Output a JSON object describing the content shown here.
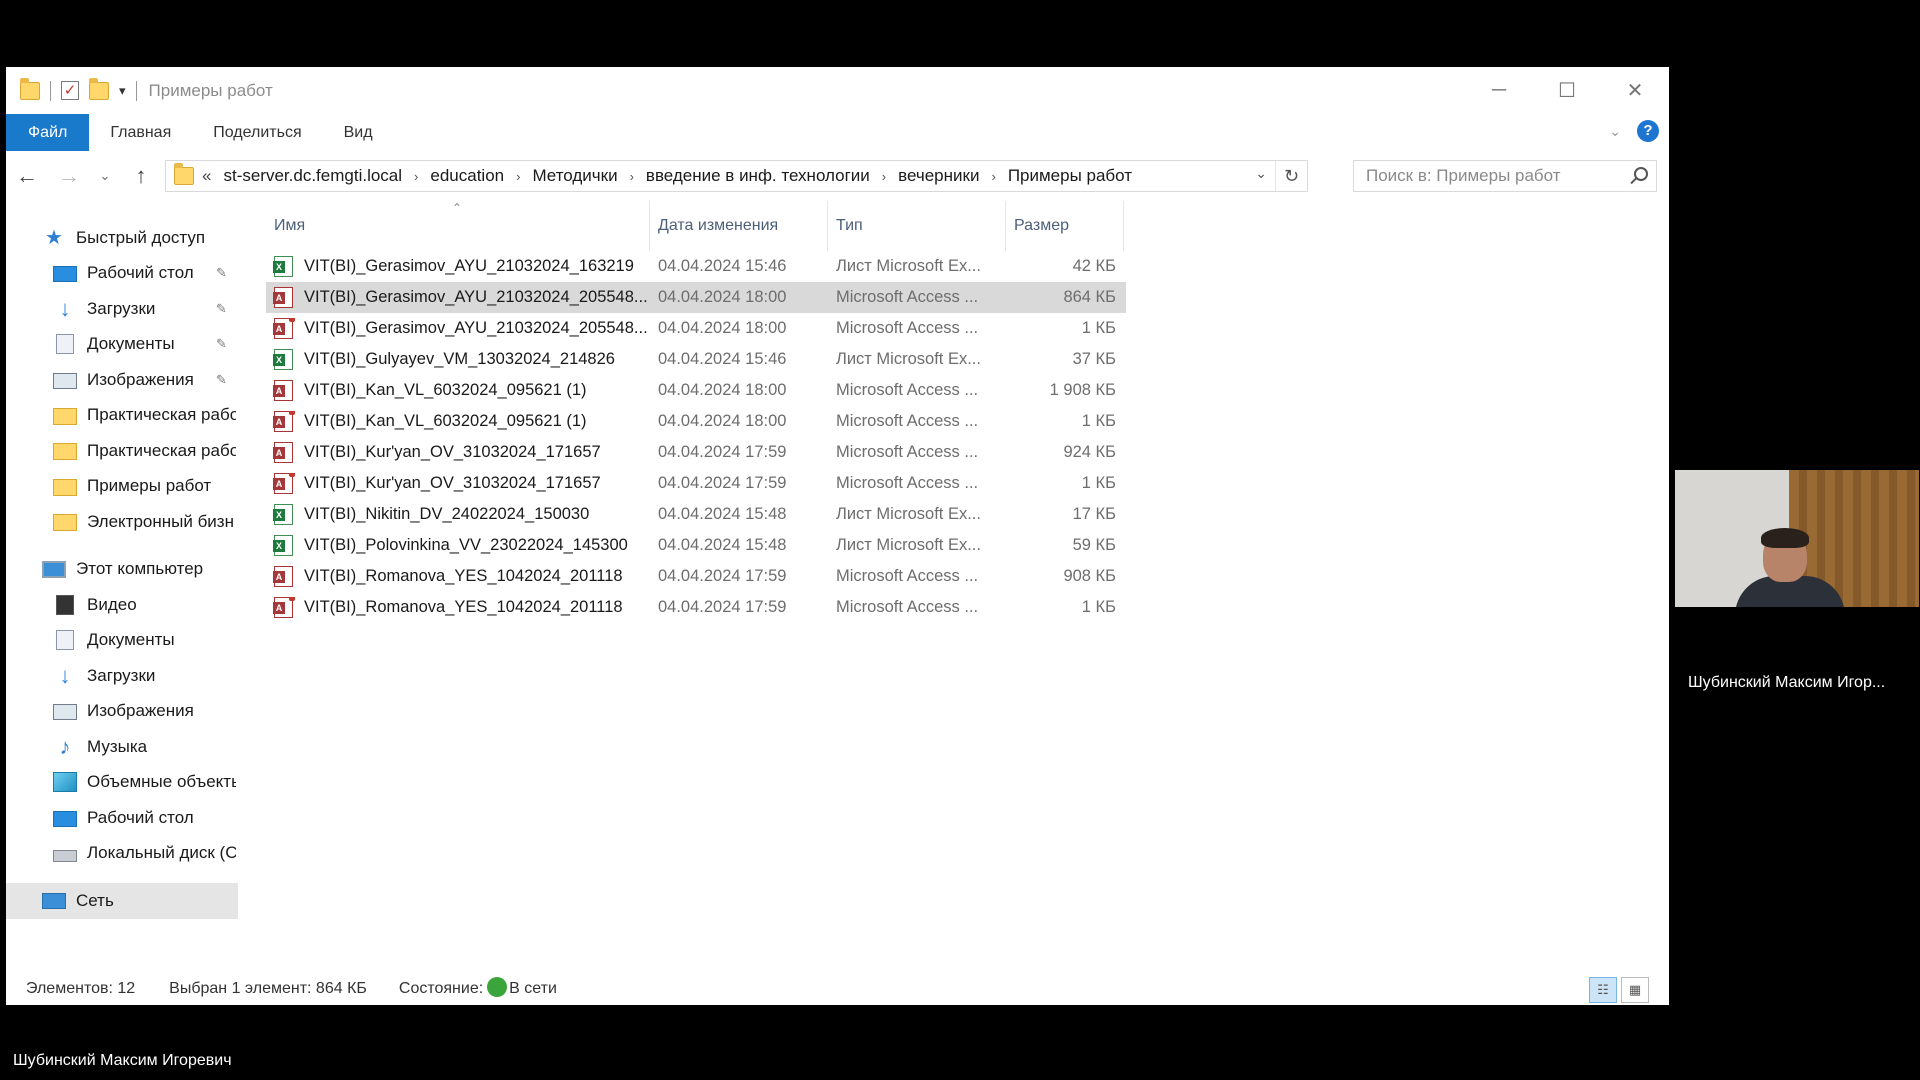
{
  "window": {
    "title": "Примеры работ",
    "controls": {
      "minimize": "─",
      "maximize": "☐",
      "close": "✕"
    }
  },
  "ribbon": {
    "tabs": [
      {
        "label": "Файл"
      },
      {
        "label": "Главная"
      },
      {
        "label": "Поделиться"
      },
      {
        "label": "Вид"
      }
    ],
    "help": "?"
  },
  "address": {
    "overflow": "«",
    "crumbs": [
      {
        "label": "st-server.dc.femgti.local"
      },
      {
        "label": "education"
      },
      {
        "label": "Методички"
      },
      {
        "label": "введение в инф. технологии"
      },
      {
        "label": "вечерники"
      },
      {
        "label": "Примеры работ"
      }
    ]
  },
  "search": {
    "placeholder": "Поиск в: Примеры работ"
  },
  "sidebar": {
    "quick_access": {
      "label": "Быстрый доступ",
      "icon": "star-icon"
    },
    "quick_items": [
      {
        "label": "Рабочий стол",
        "icon": "desktop-icon",
        "pinned": true
      },
      {
        "label": "Загрузки",
        "icon": "downloads-icon",
        "pinned": true
      },
      {
        "label": "Документы",
        "icon": "documents-icon",
        "pinned": true
      },
      {
        "label": "Изображения",
        "icon": "pictures-icon",
        "pinned": true
      },
      {
        "label": "Практическая рабо",
        "icon": "folder-icon",
        "pinned": false
      },
      {
        "label": "Практическая рабо",
        "icon": "folder-icon",
        "pinned": false
      },
      {
        "label": "Примеры работ",
        "icon": "folder-icon",
        "pinned": false
      },
      {
        "label": "Электронный бизн",
        "icon": "folder-icon",
        "pinned": false
      }
    ],
    "this_pc": {
      "label": "Этот компьютер",
      "icon": "computer-icon"
    },
    "pc_items": [
      {
        "label": "Видео",
        "icon": "video-icon"
      },
      {
        "label": "Документы",
        "icon": "documents-icon"
      },
      {
        "label": "Загрузки",
        "icon": "downloads-icon"
      },
      {
        "label": "Изображения",
        "icon": "pictures-icon"
      },
      {
        "label": "Музыка",
        "icon": "music-icon"
      },
      {
        "label": "Объемные объекты",
        "icon": "3d-objects-icon"
      },
      {
        "label": "Рабочий стол",
        "icon": "desktop-icon"
      },
      {
        "label": "Локальный диск (C",
        "icon": "disk-icon"
      }
    ],
    "network": {
      "label": "Сеть",
      "icon": "network-icon"
    }
  },
  "columns": {
    "name": "Имя",
    "date": "Дата изменения",
    "type": "Тип",
    "size": "Размер"
  },
  "files": [
    {
      "name": "VIT(BI)_Gerasimov_AYU_21032024_163219",
      "date": "04.04.2024 15:46",
      "type": "Лист Microsoft Ex...",
      "size": "42 КБ",
      "kind": "xls",
      "selected": false
    },
    {
      "name": "VIT(BI)_Gerasimov_AYU_21032024_205548...",
      "date": "04.04.2024 18:00",
      "type": "Microsoft Access ...",
      "size": "864 КБ",
      "kind": "acc",
      "selected": true
    },
    {
      "name": "VIT(BI)_Gerasimov_AYU_21032024_205548...",
      "date": "04.04.2024 18:00",
      "type": "Microsoft Access ...",
      "size": "1 КБ",
      "kind": "lock",
      "selected": false
    },
    {
      "name": "VIT(BI)_Gulyayev_VM_13032024_214826",
      "date": "04.04.2024 15:46",
      "type": "Лист Microsoft Ex...",
      "size": "37 КБ",
      "kind": "xls",
      "selected": false
    },
    {
      "name": "VIT(BI)_Kan_VL_6032024_095621 (1)",
      "date": "04.04.2024 18:00",
      "type": "Microsoft Access ...",
      "size": "1 908 КБ",
      "kind": "acc",
      "selected": false
    },
    {
      "name": "VIT(BI)_Kan_VL_6032024_095621 (1)",
      "date": "04.04.2024 18:00",
      "type": "Microsoft Access ...",
      "size": "1 КБ",
      "kind": "lock",
      "selected": false
    },
    {
      "name": "VIT(BI)_Kur'yan_OV_31032024_171657",
      "date": "04.04.2024 17:59",
      "type": "Microsoft Access ...",
      "size": "924 КБ",
      "kind": "acc",
      "selected": false
    },
    {
      "name": "VIT(BI)_Kur'yan_OV_31032024_171657",
      "date": "04.04.2024 17:59",
      "type": "Microsoft Access ...",
      "size": "1 КБ",
      "kind": "lock",
      "selected": false
    },
    {
      "name": "VIT(BI)_Nikitin_DV_24022024_150030",
      "date": "04.04.2024 15:48",
      "type": "Лист Microsoft Ex...",
      "size": "17 КБ",
      "kind": "xls",
      "selected": false
    },
    {
      "name": "VIT(BI)_Polovinkina_VV_23022024_145300",
      "date": "04.04.2024 15:48",
      "type": "Лист Microsoft Ex...",
      "size": "59 КБ",
      "kind": "xls",
      "selected": false
    },
    {
      "name": "VIT(BI)_Romanova_YES_1042024_201118",
      "date": "04.04.2024 17:59",
      "type": "Microsoft Access ...",
      "size": "908 КБ",
      "kind": "acc",
      "selected": false
    },
    {
      "name": "VIT(BI)_Romanova_YES_1042024_201118",
      "date": "04.04.2024 17:59",
      "type": "Microsoft Access ...",
      "size": "1 КБ",
      "kind": "lock",
      "selected": false
    }
  ],
  "status": {
    "count": "Элементов: 12",
    "selection": "Выбран 1 элемент: 864 КБ",
    "state_label": "Состояние:",
    "state_value": "В сети"
  },
  "meeting": {
    "participant_tile_name": "Шубинский Максим Игор...",
    "speaker_name": "Шубинский Максим Игоревич"
  },
  "colors": {
    "accent": "#1979ca",
    "selection": "#d9d9d9",
    "excel": "#1f7a3e",
    "access": "#a4373a",
    "online": "#3aa53a"
  }
}
